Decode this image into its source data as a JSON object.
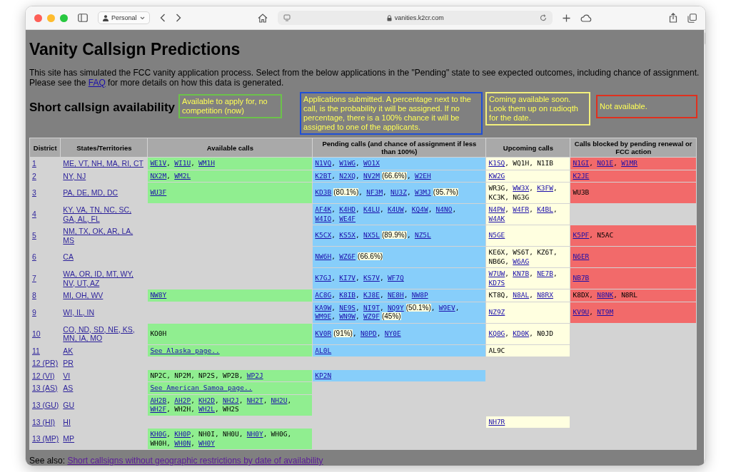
{
  "browser": {
    "profile": "Personal",
    "address": "vanities.k2cr.com"
  },
  "page": {
    "title": "Vanity Callsign Predictions",
    "intro_before": "This site has simulated the FCC vanity application process. Select from the below applications in the \"Pending\" state to see expected outcomes, including chance of assignment. Please see the",
    "intro_link": "FAQ",
    "intro_after": "for more details on how this data is generated.",
    "section_title": "Short callsign availability",
    "legend": [
      {
        "text": "Available to apply for, no competition (now)",
        "color": "#6cc24a"
      },
      {
        "text": "Applications submitted. A percentage next to the call, is the probability it will be assigned. If no percentage, there is a 100% chance it will be assigned to one of the applicants.",
        "color": "#1f4fd6"
      },
      {
        "text": "Coming available soon. Look them up on radioqth for the date.",
        "color": "#f3f07c"
      },
      {
        "text": "Not available.",
        "color": "#e0301e"
      }
    ],
    "see_also_label": "See also:",
    "see_also_link": "Short callsigns without geographic restrictions by date of availability"
  },
  "table": {
    "columns": [
      "District",
      "States/Territories",
      "Available calls",
      "Pending calls (and chance of assignment if less than 100%)",
      "Upcoming calls",
      "Calls blocked by pending renewal or FCC action"
    ],
    "rows": [
      {
        "district": "1",
        "states": "ME, VT, NH, MA, RI, CT",
        "available": [
          {
            "text": "WE1V",
            "kind": "link",
            "sep": ","
          },
          {
            "text": "WI1U",
            "kind": "link",
            "sep": ","
          },
          {
            "text": "WM1H",
            "kind": "link"
          }
        ],
        "pending": [
          {
            "text": "N1VQ",
            "kind": "link",
            "sep": ","
          },
          {
            "text": "W1WG",
            "kind": "link",
            "sep": ","
          },
          {
            "text": "WO1X",
            "kind": "link"
          }
        ],
        "upcoming": [
          {
            "text": "K1SQ",
            "kind": "link",
            "sep": ","
          },
          {
            "text": "WQ1H",
            "kind": "plain",
            "sep": ","
          },
          {
            "text": "N1IB",
            "kind": "plain"
          }
        ],
        "blocked": [
          {
            "text": "N1GI",
            "kind": "link",
            "sep": ","
          },
          {
            "text": "NO1E",
            "kind": "link",
            "sep": ","
          },
          {
            "text": "W1MR",
            "kind": "link"
          }
        ]
      },
      {
        "district": "2",
        "states": "NY, NJ",
        "available": [
          {
            "text": "NX2M",
            "kind": "link",
            "sep": ","
          },
          {
            "text": "WM2L",
            "kind": "link"
          }
        ],
        "pending": [
          {
            "text": "K2BT",
            "kind": "link",
            "sep": ","
          },
          {
            "text": "N2XQ",
            "kind": "link",
            "sep": ","
          },
          {
            "text": "NV2M",
            "kind": "link",
            "chance": "(66.6%)",
            "sep": ","
          },
          {
            "text": "W2EH",
            "kind": "link"
          }
        ],
        "upcoming": [
          {
            "text": "KW2G",
            "kind": "link"
          }
        ],
        "blocked": [
          {
            "text": "K2JE",
            "kind": "link"
          }
        ]
      },
      {
        "district": "3",
        "states": "PA, DE, MD, DC",
        "available": [
          {
            "text": "WU3F",
            "kind": "link"
          }
        ],
        "pending": [
          {
            "text": "KD3B",
            "kind": "link",
            "chance": "(80.1%)",
            "sep": ","
          },
          {
            "text": "NF3M",
            "kind": "link",
            "sep": ","
          },
          {
            "text": "NU3Z",
            "kind": "link",
            "sep": ","
          },
          {
            "text": "W3MJ",
            "kind": "link",
            "chance": "(95.7%)"
          }
        ],
        "upcoming": [
          {
            "text": "WR3G",
            "kind": "plain",
            "sep": ","
          },
          {
            "text": "WW3X",
            "kind": "link",
            "sep": ","
          },
          {
            "text": "K3FW",
            "kind": "link",
            "sep": ","
          },
          {
            "text": "KC3K",
            "kind": "plain",
            "sep": ","
          },
          {
            "text": "NG3G",
            "kind": "plain"
          }
        ],
        "blocked": [
          {
            "text": "WU3B",
            "kind": "plain"
          }
        ]
      },
      {
        "district": "4",
        "states": "KY, VA, TN, NC, SC, GA, AL, FL",
        "pending": [
          {
            "text": "AF4K",
            "kind": "link",
            "sep": ","
          },
          {
            "text": "K4HD",
            "kind": "link",
            "sep": ","
          },
          {
            "text": "K4LU",
            "kind": "link",
            "sep": ","
          },
          {
            "text": "K4UW",
            "kind": "link",
            "sep": ","
          },
          {
            "text": "KQ4W",
            "kind": "link",
            "sep": ","
          },
          {
            "text": "N4NO",
            "kind": "link",
            "sep": ","
          },
          {
            "text": "W4IO",
            "kind": "link",
            "sep": ","
          },
          {
            "text": "WE4F",
            "kind": "link"
          }
        ],
        "upcoming": [
          {
            "text": "N4PW",
            "kind": "link",
            "sep": ","
          },
          {
            "text": "W4FR",
            "kind": "link",
            "sep": ","
          },
          {
            "text": "K4BL",
            "kind": "link",
            "sep": ","
          },
          {
            "text": "W4AK",
            "kind": "link"
          }
        ]
      },
      {
        "district": "5",
        "states": "NM, TX, OK, AR, LA, MS",
        "pending": [
          {
            "text": "K5CX",
            "kind": "link",
            "sep": ","
          },
          {
            "text": "KS5X",
            "kind": "link",
            "sep": ","
          },
          {
            "text": "NX5L",
            "kind": "link",
            "chance": "(89.9%)",
            "sep": ","
          },
          {
            "text": "NZ5L",
            "kind": "link"
          }
        ],
        "upcoming": [
          {
            "text": "N5GE",
            "kind": "link"
          }
        ],
        "blocked": [
          {
            "text": "K5PF",
            "kind": "link",
            "sep": ","
          },
          {
            "text": "N5AC",
            "kind": "plain"
          }
        ]
      },
      {
        "district": "6",
        "states": "CA",
        "pending": [
          {
            "text": "NW6H",
            "kind": "link",
            "sep": ","
          },
          {
            "text": "WZ6F",
            "kind": "link",
            "chance": "(66.6%)"
          }
        ],
        "upcoming": [
          {
            "text": "KE6X",
            "kind": "plain",
            "sep": ","
          },
          {
            "text": "WS6T",
            "kind": "plain",
            "sep": ","
          },
          {
            "text": "KZ6T",
            "kind": "plain",
            "sep": ","
          },
          {
            "text": "NB6G",
            "kind": "plain",
            "sep": ","
          },
          {
            "text": "W6AG",
            "kind": "link"
          }
        ],
        "blocked": [
          {
            "text": "N6ER",
            "kind": "link"
          }
        ]
      },
      {
        "district": "7",
        "states": "WA, OR, ID, MT, WY, NV, UT, AZ",
        "pending": [
          {
            "text": "K7GJ",
            "kind": "link",
            "sep": ","
          },
          {
            "text": "KI7V",
            "kind": "link",
            "sep": ","
          },
          {
            "text": "KS7V",
            "kind": "link",
            "sep": ","
          },
          {
            "text": "WF7Q",
            "kind": "link"
          }
        ],
        "upcoming": [
          {
            "text": "W7UW",
            "kind": "link",
            "sep": ","
          },
          {
            "text": "KN7B",
            "kind": "link",
            "sep": ","
          },
          {
            "text": "NE7B",
            "kind": "link",
            "sep": ","
          },
          {
            "text": "KD7S",
            "kind": "link"
          }
        ],
        "blocked": [
          {
            "text": "NB7B",
            "kind": "link"
          }
        ]
      },
      {
        "district": "8",
        "states": "MI, OH, WV",
        "available": [
          {
            "text": "NW8Y",
            "kind": "link"
          }
        ],
        "pending": [
          {
            "text": "AC8G",
            "kind": "link",
            "sep": ","
          },
          {
            "text": "K8IB",
            "kind": "link",
            "sep": ","
          },
          {
            "text": "KJ8E",
            "kind": "link",
            "sep": ","
          },
          {
            "text": "NE8H",
            "kind": "link",
            "sep": ","
          },
          {
            "text": "NW8P",
            "kind": "link"
          }
        ],
        "upcoming": [
          {
            "text": "KT8Q",
            "kind": "plain",
            "sep": ","
          },
          {
            "text": "N8AL",
            "kind": "link",
            "sep": ","
          },
          {
            "text": "N8RX",
            "kind": "link"
          }
        ],
        "blocked": [
          {
            "text": "K8DX",
            "kind": "plain",
            "sep": ","
          },
          {
            "text": "N8NK",
            "kind": "link",
            "sep": ","
          },
          {
            "text": "N8RL",
            "kind": "plain"
          }
        ]
      },
      {
        "district": "9",
        "states": "WI, IL, IN",
        "pending": [
          {
            "text": "KA9W",
            "kind": "link",
            "sep": ","
          },
          {
            "text": "NE9S",
            "kind": "link",
            "sep": ","
          },
          {
            "text": "NI9T",
            "kind": "link",
            "sep": ","
          },
          {
            "text": "NQ9Y",
            "kind": "link",
            "chance": "(50.1%)",
            "sep": ","
          },
          {
            "text": "W9EV",
            "kind": "link",
            "sep": ","
          },
          {
            "text": "WM9E",
            "kind": "link",
            "sep": ","
          },
          {
            "text": "WN9W",
            "kind": "link",
            "sep": ","
          },
          {
            "text": "WZ9F",
            "kind": "link",
            "chance": "(45%)"
          }
        ],
        "upcoming": [
          {
            "text": "NZ9Z",
            "kind": "link"
          }
        ],
        "blocked": [
          {
            "text": "KV9U",
            "kind": "link",
            "sep": ","
          },
          {
            "text": "NT9M",
            "kind": "link"
          }
        ]
      },
      {
        "district": "10",
        "states": "CO, ND, SD, NE, KS, MN, IA, MO",
        "available": [
          {
            "text": "KO0H",
            "kind": "plain"
          }
        ],
        "pending": [
          {
            "text": "KV0R",
            "kind": "link",
            "chance": "(91%)",
            "sep": ","
          },
          {
            "text": "N0PD",
            "kind": "link",
            "sep": ","
          },
          {
            "text": "NY0E",
            "kind": "link"
          }
        ],
        "upcoming": [
          {
            "text": "KQ0G",
            "kind": "link",
            "sep": ","
          },
          {
            "text": "KD0K",
            "kind": "link",
            "sep": ","
          },
          {
            "text": "N0JD",
            "kind": "plain"
          }
        ]
      },
      {
        "district": "11",
        "states": "AK",
        "available": [
          {
            "text": "See Alaska page..",
            "kind": "page-link"
          }
        ],
        "pending": [
          {
            "text": "AL0L",
            "kind": "link"
          }
        ],
        "upcoming": [
          {
            "text": "AL9C",
            "kind": "plain"
          }
        ]
      },
      {
        "district": "12 (PR)",
        "states": "PR"
      },
      {
        "district": "12 (VI)",
        "states": "VI",
        "available": [
          {
            "text": "NP2C",
            "kind": "plain",
            "sep": ","
          },
          {
            "text": "NP2M",
            "kind": "plain",
            "sep": ","
          },
          {
            "text": "NP2S",
            "kind": "plain",
            "sep": ","
          },
          {
            "text": "WP2B",
            "kind": "plain",
            "sep": ","
          },
          {
            "text": "WP2J",
            "kind": "link"
          }
        ],
        "pending": [
          {
            "text": "KP2N",
            "kind": "link"
          }
        ]
      },
      {
        "district": "13 (AS)",
        "states": "AS",
        "available": [
          {
            "text": "See American Samoa page..",
            "kind": "page-link"
          }
        ]
      },
      {
        "district": "13 (GU)",
        "states": "GU",
        "available": [
          {
            "text": "AH2B",
            "kind": "link",
            "sep": ","
          },
          {
            "text": "AH2P",
            "kind": "link",
            "sep": ","
          },
          {
            "text": "KH2D",
            "kind": "link",
            "sep": ","
          },
          {
            "text": "NH2J",
            "kind": "link",
            "sep": ","
          },
          {
            "text": "NH2T",
            "kind": "link",
            "sep": ","
          },
          {
            "text": "NH2U",
            "kind": "link",
            "sep": ","
          },
          {
            "text": "WH2F",
            "kind": "link",
            "sep": ","
          },
          {
            "text": "WH2H",
            "kind": "plain",
            "sep": ","
          },
          {
            "text": "WH2L",
            "kind": "link",
            "sep": ","
          },
          {
            "text": "WH2S",
            "kind": "plain"
          }
        ]
      },
      {
        "district": "13 (HI)",
        "states": "HI",
        "upcoming": [
          {
            "text": "NH7R",
            "kind": "link"
          }
        ]
      },
      {
        "district": "13 (MP)",
        "states": "MP",
        "available": [
          {
            "text": "KH0G",
            "kind": "link",
            "sep": ","
          },
          {
            "text": "KH0P",
            "kind": "link",
            "sep": ","
          },
          {
            "text": "NH0I",
            "kind": "plain",
            "sep": ","
          },
          {
            "text": "NH0U",
            "kind": "plain",
            "sep": ","
          },
          {
            "text": "NH0Y",
            "kind": "link",
            "sep": ","
          },
          {
            "text": "WH0G",
            "kind": "plain",
            "sep": ","
          },
          {
            "text": "WH0H",
            "kind": "plain",
            "sep": ","
          },
          {
            "text": "WH0N",
            "kind": "link",
            "sep": ","
          },
          {
            "text": "WH0Y",
            "kind": "link"
          }
        ]
      }
    ]
  }
}
